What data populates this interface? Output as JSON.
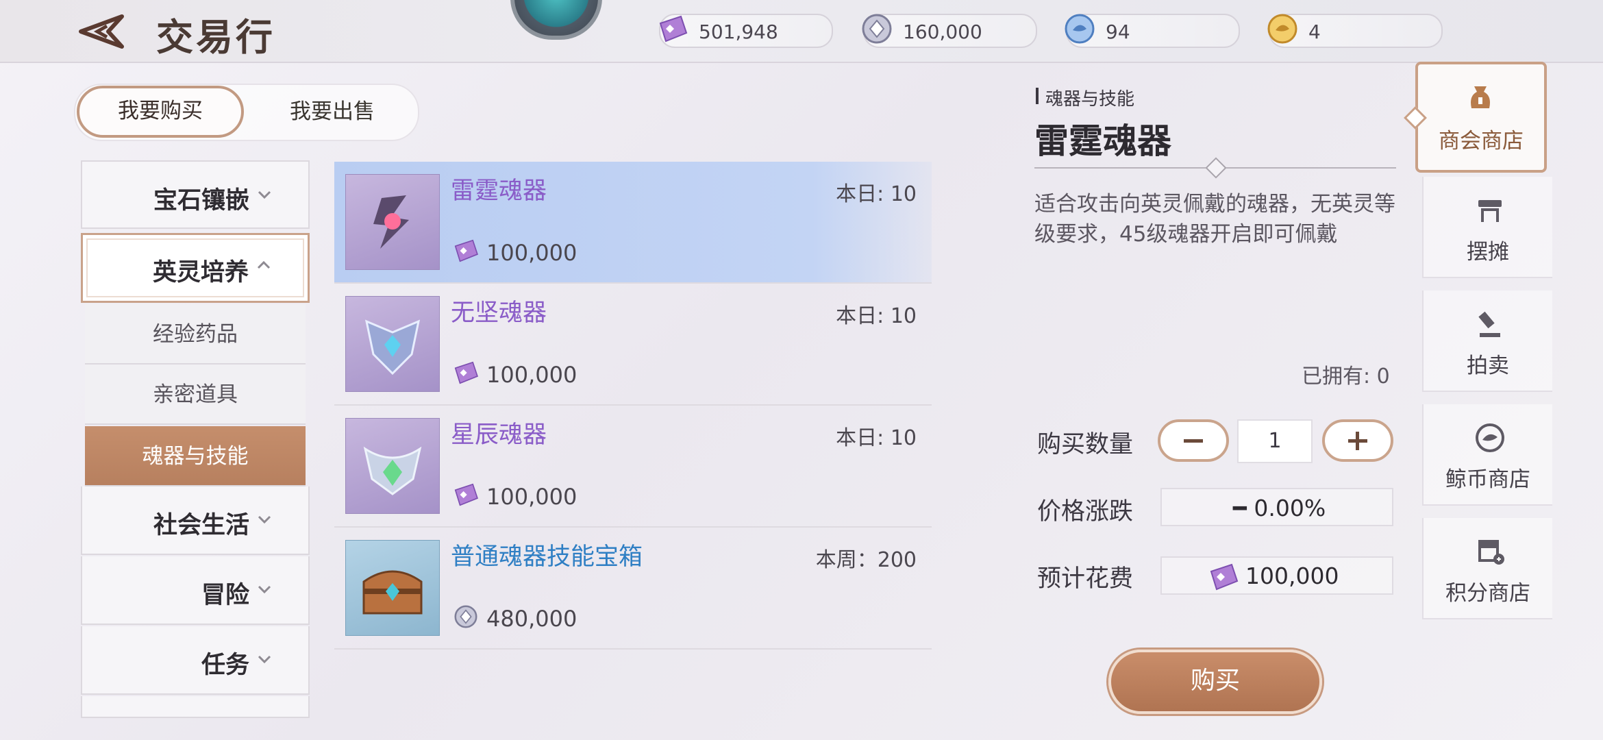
{
  "header": {
    "title": "交易行",
    "currencies": [
      {
        "icon": "purple-gem-ticket-icon",
        "value": "501,948"
      },
      {
        "icon": "silver-coin-icon",
        "value": "160,000"
      },
      {
        "icon": "blue-whale-coin-icon",
        "value": "94"
      },
      {
        "icon": "gold-whale-coin-icon",
        "value": "4"
      }
    ]
  },
  "tabs": {
    "buy": "我要购买",
    "sell": "我要出售"
  },
  "categories": {
    "gem": "宝石镶嵌",
    "hero": "英灵培养",
    "sub": [
      "经验药品",
      "亲密道具",
      "魂器与技能"
    ],
    "social": "社会生活",
    "adventure": "冒险",
    "quest": "任务"
  },
  "items": [
    {
      "name": "雷霆魂器",
      "limit": "本日: 10",
      "price": "100,000",
      "currency": "purple-gem-ticket-icon"
    },
    {
      "name": "无坚魂器",
      "limit": "本日: 10",
      "price": "100,000",
      "currency": "purple-gem-ticket-icon"
    },
    {
      "name": "星辰魂器",
      "limit": "本日: 10",
      "price": "100,000",
      "currency": "purple-gem-ticket-icon"
    },
    {
      "name": "普通魂器技能宝箱",
      "limit": "本周：200",
      "price": "480,000",
      "currency": "silver-coin-icon"
    }
  ],
  "detail": {
    "category": "魂器与技能",
    "title": "雷霆魂器",
    "description": "适合攻击向英灵佩戴的魂器，无英灵等级要求，45级魂器开启即可佩戴",
    "owned": "已拥有: 0",
    "qty_label": "购买数量",
    "qty_value": "1",
    "minus": "−",
    "plus": "+",
    "change_label": "价格涨跌",
    "change_value": "━ 0.00%",
    "cost_label": "预计花费",
    "cost_value": "100,000",
    "buy_label": "购买"
  },
  "sidebar": {
    "items": [
      {
        "label": "商会商店",
        "icon": "money-bag-icon"
      },
      {
        "label": "摆摊",
        "icon": "stall-icon"
      },
      {
        "label": "拍卖",
        "icon": "gavel-icon"
      },
      {
        "label": "鲸币商店",
        "icon": "whale-coin-icon"
      },
      {
        "label": "积分商店",
        "icon": "points-shop-icon"
      }
    ]
  },
  "colors": {
    "accent": "#b8805f",
    "selected_row": "#c3d4f4",
    "item_name_purple": "#8a5cc8",
    "item_name_blue": "#2f7fc4"
  }
}
